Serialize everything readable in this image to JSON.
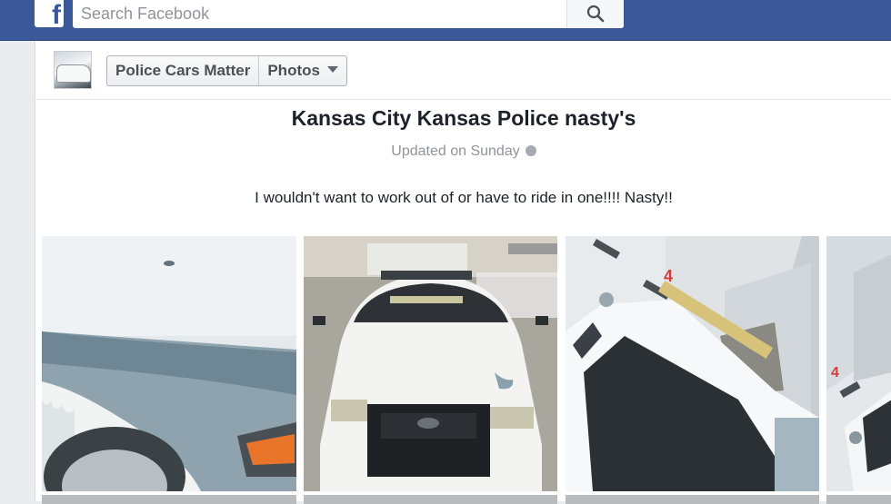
{
  "topbar": {
    "logo_letter": "f",
    "search_placeholder": "Search Facebook"
  },
  "page": {
    "name": "Police Cars Matter",
    "section": "Photos"
  },
  "album": {
    "title": "Kansas City Kansas Police nasty's",
    "updated": "Updated on Sunday",
    "description": "I wouldn't want to work out of or have to ride in one!!!! Nasty!!"
  },
  "photos": [
    {
      "subject": "close-up of white car fender with peeling paint"
    },
    {
      "subject": "front of white police cruiser with push bumper"
    },
    {
      "subject": "white police car with light bar in front of garage door"
    },
    {
      "subject": "partial police car near garage door"
    }
  ],
  "colors": {
    "brand": "#3b5998",
    "background": "#e9ebee"
  }
}
